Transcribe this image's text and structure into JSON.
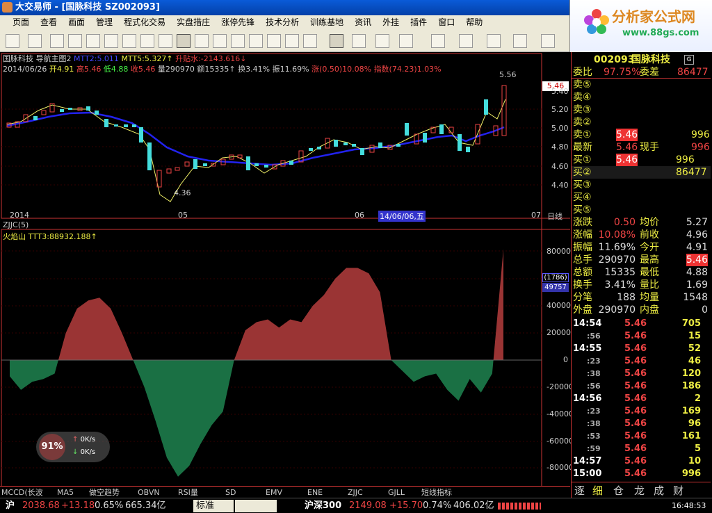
{
  "window": {
    "title": "大交易师 - [国脉科技 SZ002093]"
  },
  "menu": [
    "页面",
    "查看",
    "画面",
    "管理",
    "程式化交易",
    "实盘措庄",
    "涨停先锋",
    "技术分析",
    "训练基地",
    "资讯",
    "外挂",
    "插件",
    "窗口",
    "帮助"
  ],
  "logo": {
    "name": "分析家公式网",
    "url": "www.88gs.com"
  },
  "chart": {
    "header1": "国脉科技 导航主图2",
    "header1_ma": "MTT2:5.011",
    "header1_ma5": "MTT5:5.327↑",
    "header1_sheng": "升贴水:-2143.616↓",
    "header2_date": "2014/06/26",
    "header2_open": "开4.91",
    "header2_high": "高5.46",
    "header2_low": "低4.88",
    "header2_close": "收5.46",
    "header2_vol": "量290970",
    "header2_amt": "额15335↑",
    "header2_turn": "换3.41%",
    "header2_amp": "振11.69%",
    "header2_chg": "涨(0.50)10.08%",
    "header2_idx": "指数(74.23)1.03%",
    "price_axis": [
      "5.46",
      "5.40",
      "5.20",
      "5.00",
      "4.80",
      "4.60",
      "4.40"
    ],
    "high_label": "5.56",
    "low_label": "4.36",
    "date_axis": [
      "2014",
      "05",
      "06",
      "07"
    ],
    "date_cursor": "14/06/06,五",
    "period": "日线",
    "ind_name": "ZJJC(5)",
    "ind_line": "火焰山 TTT3:88932.188↑",
    "ind_axis": [
      "80000",
      "60000",
      "40000",
      "20000",
      "0",
      "-20000",
      "-40000",
      "-60000",
      "-80000"
    ],
    "ind_box1": "(1786)",
    "ind_box2": "49757"
  },
  "chart_data": {
    "type": "area",
    "ylim": [
      -90000,
      90000
    ],
    "values": [
      -12000,
      -22000,
      -16000,
      -14000,
      -10000,
      20000,
      38000,
      44000,
      46000,
      38000,
      20000,
      0,
      -20000,
      -45000,
      -72000,
      -86000,
      -78000,
      -62000,
      -48000,
      -38000,
      0,
      22000,
      28000,
      30000,
      24000,
      30000,
      28000,
      40000,
      48000,
      60000,
      68000,
      68000,
      64000,
      50000,
      0,
      -8000,
      -16000,
      -12000,
      -10000,
      -22000,
      -30000,
      -14000,
      -24000,
      -10000,
      82000
    ]
  },
  "tabs": [
    "MCCD(长波",
    "MA5",
    "做空趋势",
    "OBVN",
    "RSI量",
    "SD",
    "EMV",
    "ENE",
    "ZJJC",
    "GJLL",
    "短线指标"
  ],
  "quote": {
    "code": "002093",
    "name": "国脉科技",
    "weibi_label": "委比",
    "weibi": "97.75%",
    "weicha_label": "委差",
    "weicha": "86477",
    "sells": [
      {
        "label": "卖⑤",
        "price": "",
        "vol": ""
      },
      {
        "label": "卖④",
        "price": "",
        "vol": ""
      },
      {
        "label": "卖③",
        "price": "",
        "vol": ""
      },
      {
        "label": "卖②",
        "price": "",
        "vol": ""
      },
      {
        "label": "卖①",
        "price": "5.46",
        "vol": "996"
      }
    ],
    "latest_label": "最新",
    "latest": "5.46",
    "xianshou_label": "现手",
    "xianshou": "996",
    "buys": [
      {
        "label": "买①",
        "price": "5.46",
        "vol": "996"
      },
      {
        "label": "买②",
        "price": "",
        "vol": "86477"
      },
      {
        "label": "买③",
        "price": "",
        "vol": ""
      },
      {
        "label": "买④",
        "price": "",
        "vol": ""
      },
      {
        "label": "买⑤",
        "price": "",
        "vol": ""
      }
    ],
    "stats": [
      {
        "l1": "涨跌",
        "v1": "0.50",
        "l2": "均价",
        "v2": "5.27"
      },
      {
        "l1": "涨幅",
        "v1": "10.08%",
        "l2": "前收",
        "v2": "4.96"
      },
      {
        "l1": "振幅",
        "v1": "11.69%",
        "l2": "今开",
        "v2": "4.91"
      },
      {
        "l1": "总手",
        "v1": "290970",
        "l2": "最高",
        "v2": "5.46"
      },
      {
        "l1": "总额",
        "v1": "15335",
        "l2": "最低",
        "v2": "4.88"
      },
      {
        "l1": "换手",
        "v1": "3.41%",
        "l2": "量比",
        "v2": "1.69"
      },
      {
        "l1": "分笔",
        "v1": "188",
        "l2": "均量",
        "v2": "1548"
      },
      {
        "l1": "外盘",
        "v1": "290970",
        "l2": "内盘",
        "v2": "0"
      }
    ],
    "ticks": [
      {
        "t": "14:54",
        "p": "5.46",
        "v": "705"
      },
      {
        "t": ":56",
        "p": "5.46",
        "v": "15"
      },
      {
        "t": "14:55",
        "p": "5.46",
        "v": "52"
      },
      {
        "t": ":23",
        "p": "5.46",
        "v": "46"
      },
      {
        "t": ":38",
        "p": "5.46",
        "v": "120"
      },
      {
        "t": ":56",
        "p": "5.46",
        "v": "186"
      },
      {
        "t": "14:56",
        "p": "5.46",
        "v": "2"
      },
      {
        "t": ":23",
        "p": "5.46",
        "v": "169"
      },
      {
        "t": ":38",
        "p": "5.46",
        "v": "96"
      },
      {
        "t": ":53",
        "p": "5.46",
        "v": "161"
      },
      {
        "t": ":59",
        "p": "5.46",
        "v": "5"
      },
      {
        "t": "14:57",
        "p": "5.46",
        "v": "10"
      },
      {
        "t": "15:00",
        "p": "5.46",
        "v": "996"
      }
    ],
    "bottom_tabs": [
      "逐",
      "细",
      "仓",
      "龙",
      "成",
      "财"
    ]
  },
  "gauge": {
    "pct": "91%",
    "up": "0K/s",
    "down": "0K/s"
  },
  "status": {
    "sh_label": "沪",
    "sh_idx": "2038.68",
    "sh_chg": "+13.18",
    "sh_pct": "0.65%",
    "sh_amt": "665.34亿",
    "std_label": "标准",
    "hs_label": "沪深300",
    "hs_idx": "2149.08",
    "hs_chg": "+15.70",
    "hs_pct": "0.74%",
    "hs_amt": "406.02亿",
    "time": "16:48:53"
  }
}
